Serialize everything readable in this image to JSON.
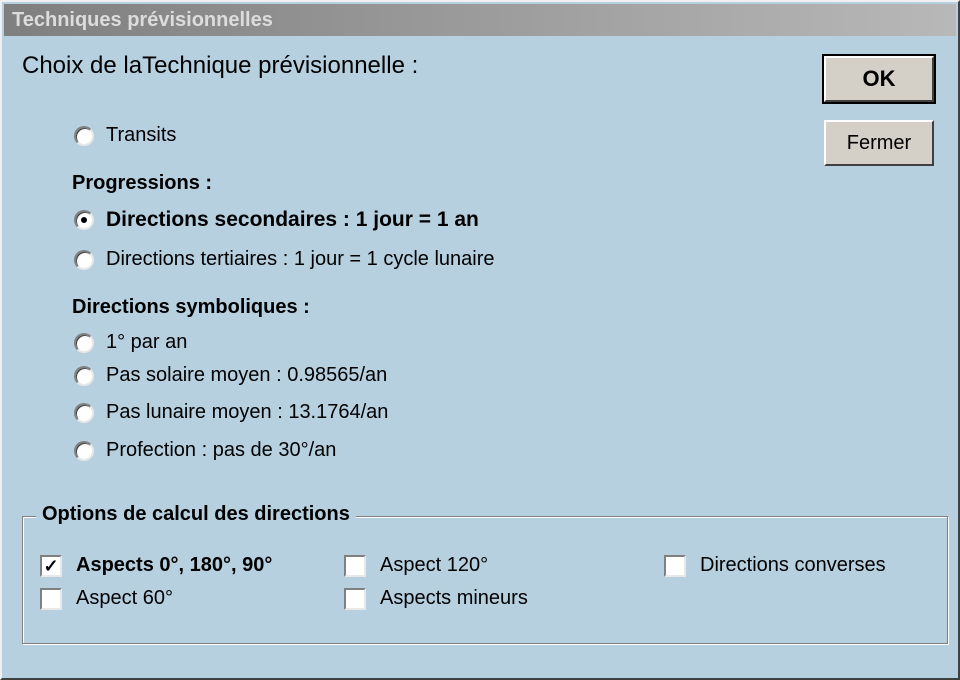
{
  "window": {
    "title": "Techniques prévisionnelles"
  },
  "heading": "Choix de laTechnique prévisionnelle :",
  "buttons": {
    "ok": "OK",
    "close": "Fermer"
  },
  "options": {
    "transits": "Transits",
    "progressions_label": "Progressions :",
    "secondary": "Directions secondaires : 1 jour = 1 an",
    "tertiary": "Directions tertiaires : 1 jour = 1 cycle lunaire",
    "symbolic_label": "Directions symboliques :",
    "one_degree": " 1° par an",
    "solar": "Pas solaire moyen : 0.98565/an",
    "lunar": "Pas lunaire moyen : 13.1764/an",
    "profection": "Profection : pas de 30°/an"
  },
  "selected": "secondary",
  "calc_options": {
    "legend": "Options de calcul des directions",
    "aspects_major": "Aspects 0°, 180°, 90°",
    "aspect_60": "Aspect 60°",
    "aspect_120": "Aspect 120°",
    "aspects_minor": "Aspects mineurs",
    "converse": "Directions converses",
    "checked": [
      "aspects_major"
    ]
  }
}
